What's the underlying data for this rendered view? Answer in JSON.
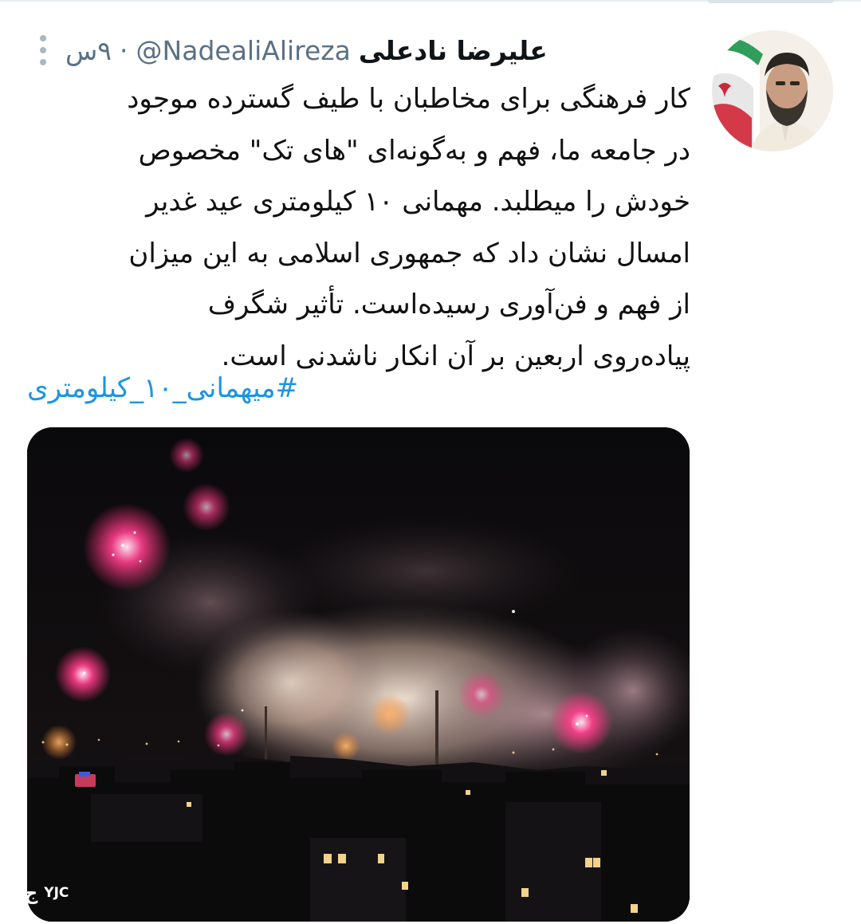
{
  "tweet": {
    "display_name": "علیرضا نادعلی",
    "handle": "@NadealiAlireza",
    "separator": "·",
    "time": "۹س",
    "text_lines": [
      "کار فرهنگی برای مخاطبان با طیف گسترده موجود",
      "در جامعه ما، فهم و به‌گونه‌ای \"های تک\" مخصوص",
      "خودش را میطلبد. مهمانی ۱۰ کیلومتری عید غدیر",
      "امسال نشان داد که جمهوری اسلامی به این میزان",
      "از فهم و فن‌آوری رسیده‌است. تأثیر شگرف",
      "پیاده‌روی اربعین بر آن انکار ناشدنی است."
    ],
    "hashtag": "#میهمانی_۱۰_کیلومتری"
  },
  "watermark": {
    "text": "YJC",
    "mark": "ج"
  },
  "icons": {
    "more": "more-vertical-icon",
    "avatar": "profile-photo",
    "media": "fireworks-photo"
  },
  "colors": {
    "link": "#1b95e0",
    "secondary_text": "#5b7083",
    "primary_text": "#0f1419"
  }
}
